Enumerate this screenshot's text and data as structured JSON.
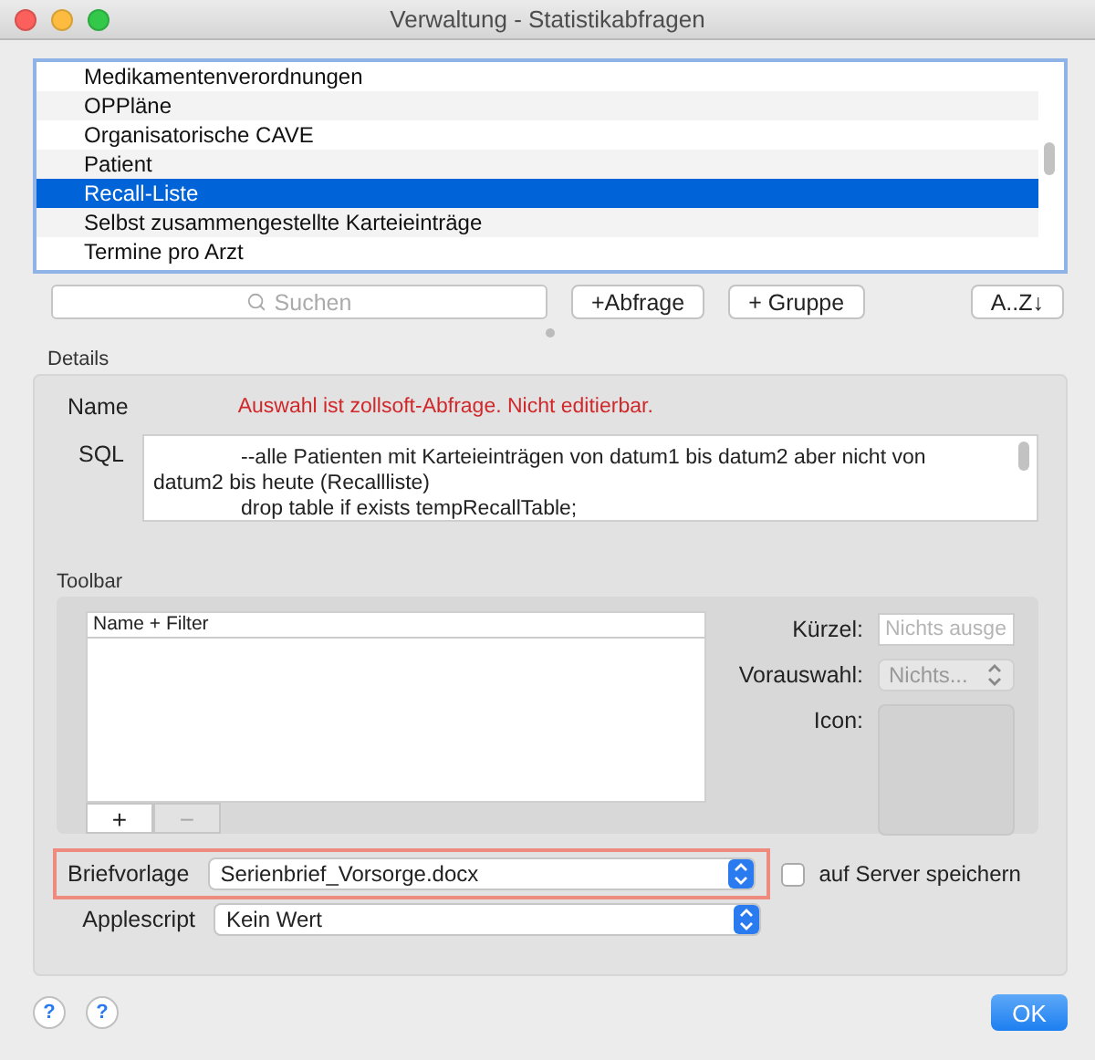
{
  "window": {
    "title": "Verwaltung - Statistikabfragen"
  },
  "query_list": {
    "items": [
      {
        "label": "Medikamentenverordnungen",
        "selected": false
      },
      {
        "label": "OPPläne",
        "selected": false
      },
      {
        "label": "Organisatorische CAVE",
        "selected": false
      },
      {
        "label": "Patient",
        "selected": false
      },
      {
        "label": "Recall-Liste",
        "selected": true
      },
      {
        "label": "Selbst zusammengestellte Karteieinträge",
        "selected": false
      },
      {
        "label": "Termine pro Arzt",
        "selected": false
      }
    ]
  },
  "search": {
    "placeholder": "Suchen"
  },
  "buttons": [
    "+Abfrage",
    "+ Gruppe"
  ],
  "sort_button": "A..Z↓",
  "details": {
    "title": "Details",
    "name_label": "Name",
    "name_value": "Auswahl ist zollsoft-Abfrage. Nicht editierbar.",
    "sql_label": "SQL",
    "sql_lines": [
      "--alle Patienten mit Karteieinträgen von datum1 bis datum2 aber nicht von datum2 bis heute (Recallliste)",
      "drop table if exists tempRecallTable;"
    ]
  },
  "toolbar": {
    "title": "Toolbar",
    "list_header": "Name + Filter",
    "add": "+",
    "remove": "−",
    "remove_disabled": true,
    "shortcut": {
      "label": "Kürzel:",
      "placeholder": "Nichts ausge"
    },
    "preselect": {
      "label": "Vorauswahl:",
      "value": "Nichts...",
      "disabled": true
    },
    "icon": {
      "label": "Icon:"
    }
  },
  "template": {
    "label": "Briefvorlage",
    "value": "Serienbrief_Vorsorge.docx",
    "highlighted": true
  },
  "save_on_server": {
    "label": "auf Server speichern",
    "checked": false
  },
  "applescript": {
    "label": "Applescript",
    "value": "Kein Wert"
  },
  "help_buttons": [
    "?",
    "?"
  ],
  "ok_button": "OK"
}
